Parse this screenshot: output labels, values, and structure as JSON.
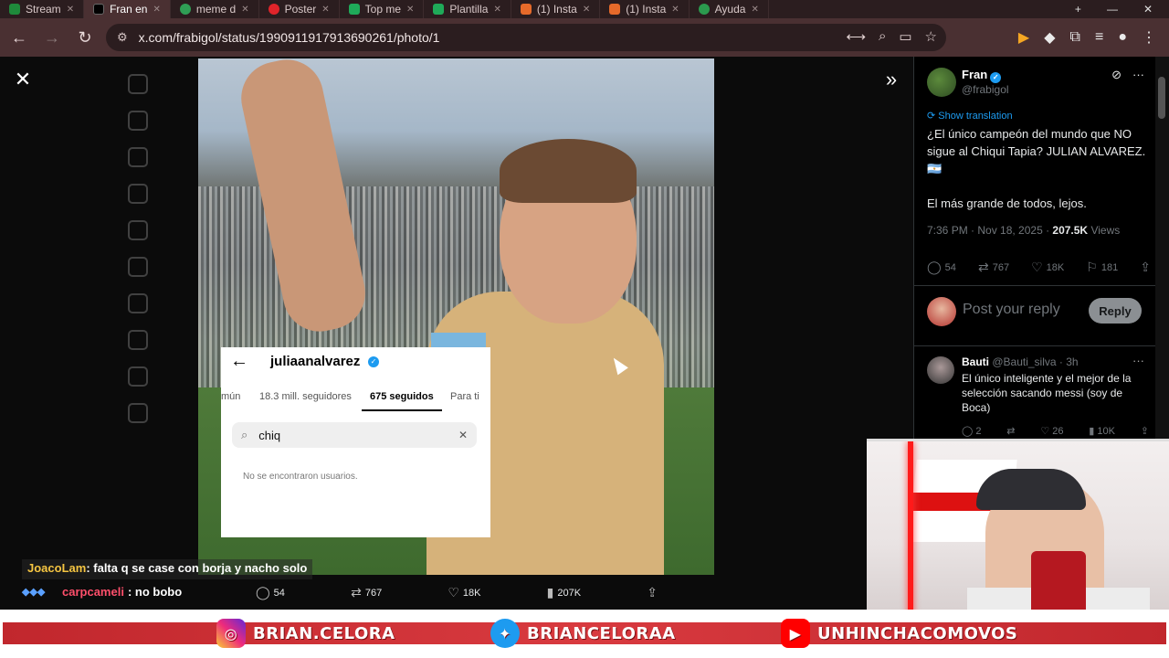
{
  "browser": {
    "tabs": [
      {
        "label": "Stream",
        "color": "#1f8a3b"
      },
      {
        "label": "Fran en",
        "color": "#000000",
        "active": true
      },
      {
        "label": "meme d",
        "color": "#2f9e55"
      },
      {
        "label": "Poster",
        "color": "#e0242a"
      },
      {
        "label": "Top me",
        "color": "#1faa59"
      },
      {
        "label": "Plantilla",
        "color": "#1faa59"
      },
      {
        "label": "(1) Insta",
        "color": "#e66a2a"
      },
      {
        "label": "(1) Insta",
        "color": "#e66a2a"
      },
      {
        "label": "Ayuda",
        "color": "#2b9a4e"
      }
    ],
    "url": "x.com/frabigol/status/1990911917913690261/photo/1"
  },
  "photo_actions": {
    "replies": "54",
    "reposts": "767",
    "likes": "18K",
    "views": "207K"
  },
  "instagram": {
    "username": "juliaanalvarez",
    "tabs": [
      "mún",
      "18.3 mill. seguidores",
      "675 seguidos",
      "Para ti"
    ],
    "search_value": "chiq",
    "empty_message": "No se encontraron usuarios."
  },
  "chat": [
    {
      "nick": "JoacoLam",
      "message": ": falta q se case con borja y nacho solo"
    },
    {
      "nick": "carpcameli",
      "message": ": no bobo"
    }
  ],
  "tweet": {
    "author": "Fran",
    "handle": "@frabigol",
    "translate": "Show translation",
    "text_line1": "¿El único campeón del mundo que NO sigue al Chiqui Tapia? JULIAN ALVAREZ. 🇦🇷",
    "text_line2": "El más grande de todos, lejos.",
    "time": "7:36 PM · Nov 18, 2025 · ",
    "views_count": "207.5K",
    "views_label": " Views",
    "replies": "54",
    "reposts": "767",
    "likes": "18K",
    "bookmarks": "181",
    "reply_placeholder": "Post your reply",
    "reply_button": "Reply"
  },
  "comment": {
    "author": "Bauti",
    "handle": "@Bauti_silva · 3h",
    "text": "El único inteligente y el mejor de la selección sacando messi (soy de Boca)",
    "replies": "2",
    "reposts": "",
    "likes": "26",
    "views": "10K"
  },
  "banner": {
    "instagram": "BRIAN.CELORA",
    "twitter": "BRIANCELORAA",
    "youtube": "UNHINCHACOMOVOS"
  }
}
